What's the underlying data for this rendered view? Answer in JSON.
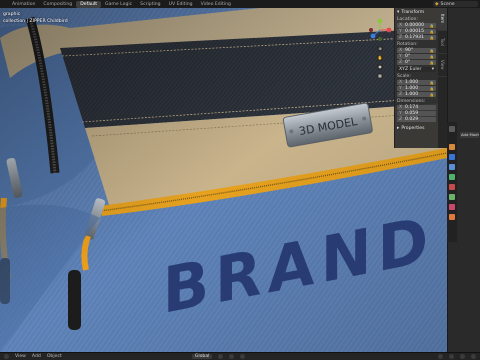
{
  "topbar": {
    "tabs": [
      {
        "label": "Animation",
        "active": false
      },
      {
        "label": "Compositing",
        "active": false
      },
      {
        "label": "Default",
        "active": true
      },
      {
        "label": "Game Logic",
        "active": false
      },
      {
        "label": "Scripting",
        "active": false
      },
      {
        "label": "UV Editing",
        "active": false
      },
      {
        "label": "Video Editing",
        "active": false
      }
    ],
    "scene_label": "Scene"
  },
  "viewport": {
    "info_line1": "graphic",
    "info_line2": "collection | ZIPPER Childbird",
    "plate_text": "3D MODEL",
    "brand_text": "BRAND"
  },
  "npanel": {
    "header": "Transform",
    "location": {
      "label": "Location:",
      "x": "0.00000",
      "y": "0.00015",
      "z": "0.17931"
    },
    "rotation": {
      "label": "Rotation:",
      "x": "90°",
      "y": "0°",
      "z": "0°"
    },
    "rotation_mode": "XYZ Euler",
    "scale": {
      "label": "Scale:",
      "x": "1.000",
      "y": "1.000",
      "z": "1.000"
    },
    "dimensions": {
      "label": "Dimensions:",
      "x": "0.174",
      "y": "0.059",
      "z": "0.029"
    },
    "properties": "Properties",
    "tabs": [
      "Item",
      "Tool",
      "View"
    ]
  },
  "props": {
    "add_modifier": "Add Modifier"
  },
  "bottombar": {
    "menu": [
      "View",
      "Add",
      "Object"
    ],
    "transform_orientation": "Global"
  },
  "colors": {
    "fabric": "#5f83b8",
    "trim": "#c8b48e",
    "strap": "#2a2f38",
    "zipper_tape": "#e6a11e",
    "brand_text": "#283c73",
    "plate": "#9aa3ab"
  }
}
